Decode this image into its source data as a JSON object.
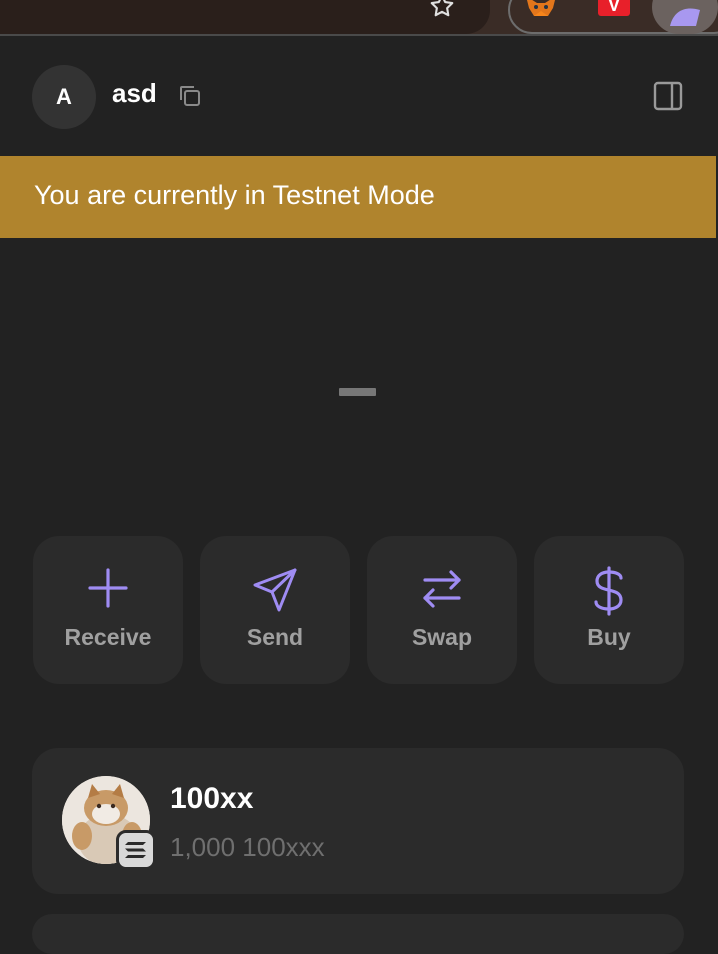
{
  "browser": {
    "extensions": [
      "star-icon",
      "metamask-fox-icon",
      "v-extension-icon",
      "wallet-extension-icon"
    ],
    "v_extension_letter": "V"
  },
  "header": {
    "avatar_letter": "A",
    "account_name": "asd"
  },
  "banner": {
    "text": "You are currently in Testnet Mode",
    "color": "#b0842d"
  },
  "balance": {
    "display": "loading-dash"
  },
  "actions": [
    {
      "label": "Receive",
      "icon": "plus-icon"
    },
    {
      "label": "Send",
      "icon": "paper-plane-icon"
    },
    {
      "label": "Swap",
      "icon": "swap-arrows-icon"
    },
    {
      "label": "Buy",
      "icon": "dollar-icon"
    }
  ],
  "tokens": [
    {
      "name": "100xx",
      "balance": "1,000 100xxx",
      "icon": "cat-token-icon",
      "chain_icon": "solana-chain-icon"
    }
  ],
  "colors": {
    "accent": "#9f8cf3",
    "background": "#222222",
    "card": "#2b2b2b"
  }
}
